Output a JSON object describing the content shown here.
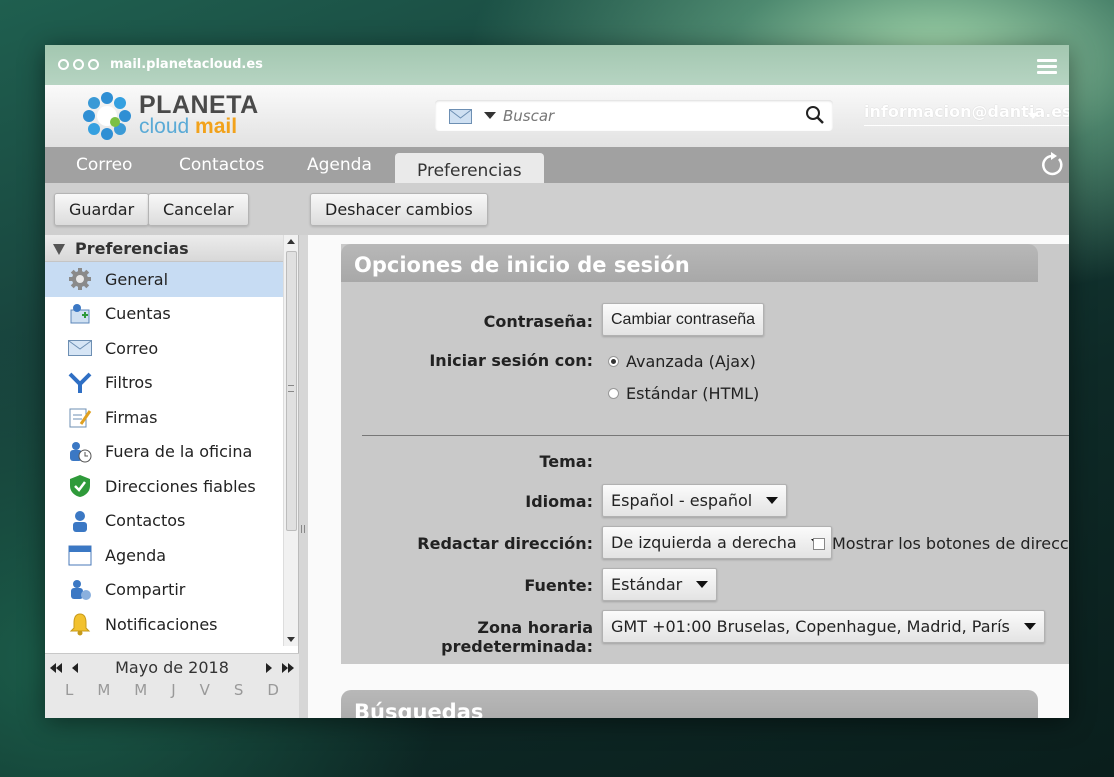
{
  "browser": {
    "url": "mail.planetacloud.es"
  },
  "logo": {
    "line1": "PLANETA",
    "line2a": "cloud ",
    "line2b": "mail"
  },
  "search": {
    "placeholder": "Buscar"
  },
  "user": {
    "email": "informacion@dantia.es"
  },
  "tabs": [
    {
      "label": "Correo"
    },
    {
      "label": "Contactos"
    },
    {
      "label": "Agenda"
    },
    {
      "label": "Preferencias",
      "active": true
    }
  ],
  "toolbar": {
    "save": "Guardar",
    "cancel": "Cancelar",
    "undo": "Deshacer cambios"
  },
  "sidebar": {
    "title": "Preferencias",
    "items": [
      {
        "label": "General",
        "icon": "gear-icon",
        "selected": true
      },
      {
        "label": "Cuentas",
        "icon": "accounts-icon"
      },
      {
        "label": "Correo",
        "icon": "envelope-icon"
      },
      {
        "label": "Filtros",
        "icon": "filter-icon"
      },
      {
        "label": "Firmas",
        "icon": "signature-icon"
      },
      {
        "label": "Fuera de la oficina",
        "icon": "out-of-office-icon"
      },
      {
        "label": "Direcciones fiables",
        "icon": "shield-check-icon"
      },
      {
        "label": "Contactos",
        "icon": "contact-icon"
      },
      {
        "label": "Agenda",
        "icon": "calendar-icon"
      },
      {
        "label": "Compartir",
        "icon": "share-icon"
      },
      {
        "label": "Notificaciones",
        "icon": "bell-icon"
      }
    ]
  },
  "calendar": {
    "month": "Mayo de 2018",
    "days": [
      "L",
      "M",
      "M",
      "J",
      "V",
      "S",
      "D"
    ]
  },
  "login_section": {
    "title": "Opciones de inicio de sesión",
    "password_label": "Contraseña:",
    "password_button": "Cambiar contraseña",
    "login_with_label": "Iniciar sesión con:",
    "login_options": [
      {
        "label": "Avanzada (Ajax)",
        "checked": true
      },
      {
        "label": "Estándar (HTML)",
        "checked": false
      }
    ],
    "theme_label": "Tema:",
    "language_label": "Idioma:",
    "language_value": "Español - español",
    "compose_dir_label": "Redactar dirección:",
    "compose_dir_value": "De izquierda a derecha",
    "show_dir_buttons_label": "Mostrar los botones de dirección",
    "font_label": "Fuente:",
    "font_value": "Estándar",
    "timezone_label": "Zona horaria predeterminada:",
    "timezone_value": "GMT +01:00 Bruselas, Copenhague, Madrid, París"
  },
  "next_section": {
    "title": "Búsquedas"
  },
  "colors": {
    "tabbar": "#a1a1a1",
    "selected": "#c7dcf3",
    "section": "#c9c9c9",
    "section_header": "#b0b0b0",
    "logo_blue": "#5aaad6",
    "logo_orange": "#f2a21b"
  }
}
